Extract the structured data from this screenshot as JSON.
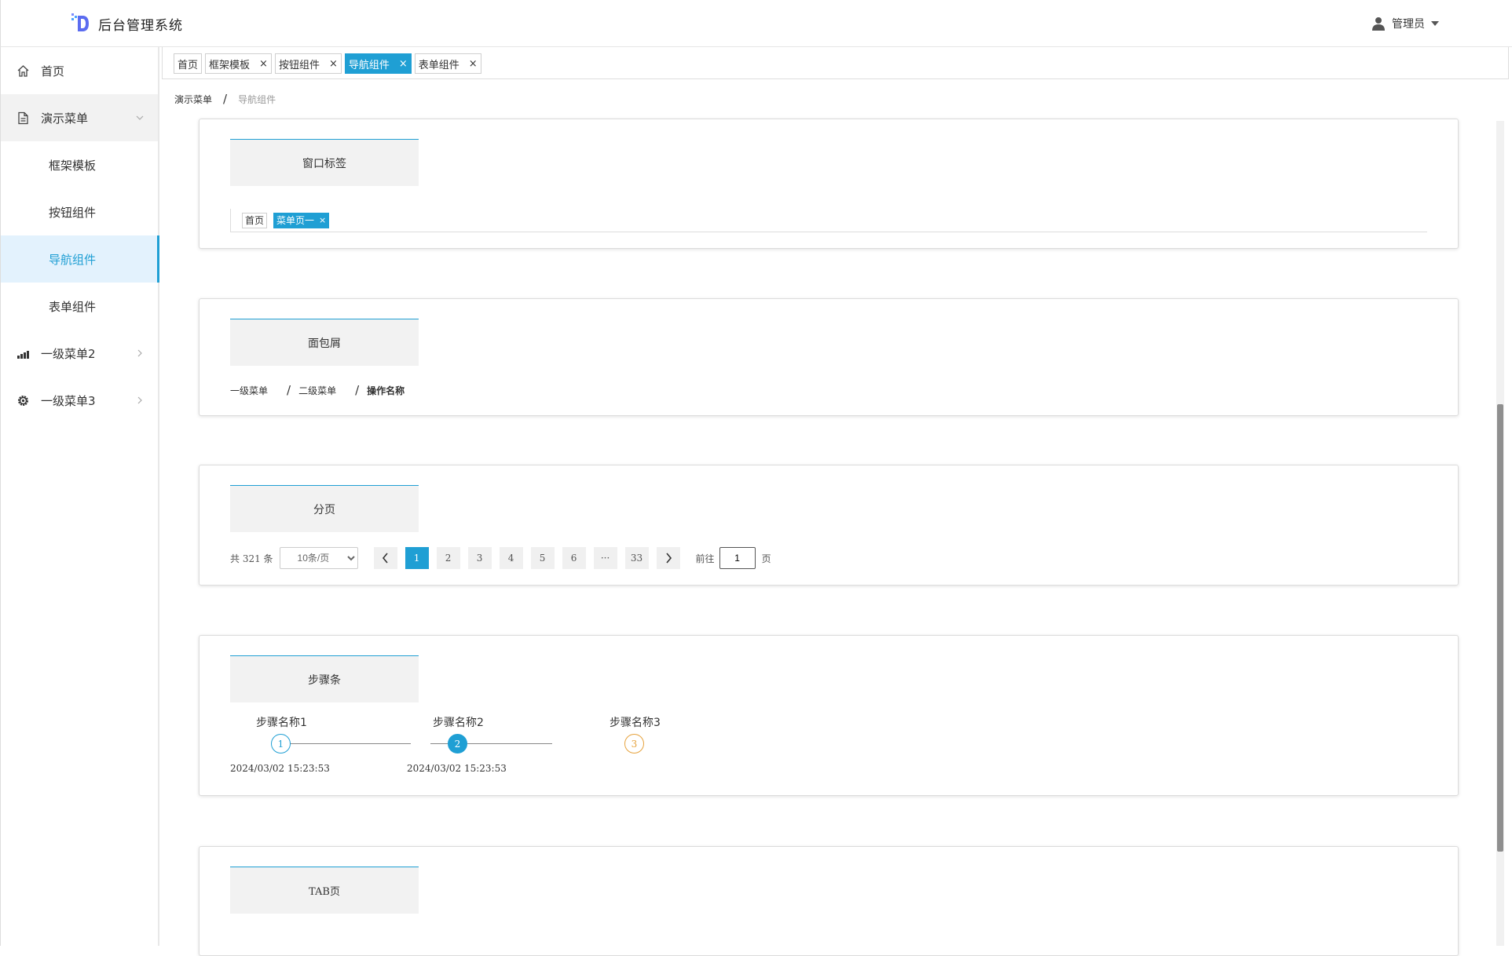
{
  "app": {
    "title": "后台管理系统"
  },
  "user": {
    "name": "管理员"
  },
  "sidebar": {
    "items": [
      {
        "label": "首页",
        "icon": "home-icon"
      },
      {
        "label": "演示菜单",
        "icon": "document-icon"
      },
      {
        "label": "框架模板"
      },
      {
        "label": "按钮组件"
      },
      {
        "label": "导航组件"
      },
      {
        "label": "表单组件"
      },
      {
        "label": "一级菜单2",
        "icon": "bar-chart-icon"
      },
      {
        "label": "一级菜单3",
        "icon": "gear-icon"
      }
    ],
    "active": "导航组件"
  },
  "tabs": [
    {
      "label": "首页",
      "closable": false
    },
    {
      "label": "框架模板",
      "closable": true
    },
    {
      "label": "按钮组件",
      "closable": true
    },
    {
      "label": "导航组件",
      "closable": true,
      "active": true
    },
    {
      "label": "表单组件",
      "closable": true
    }
  ],
  "close_glyph": "×",
  "breadcrumb": {
    "parent": "演示菜单",
    "current": "导航组件",
    "separator": "/"
  },
  "cards": {
    "window_tags": {
      "title": "窗口标签",
      "tags": [
        {
          "label": "首页"
        },
        {
          "label": "菜单页一",
          "active": true
        }
      ]
    },
    "breadcrumb": {
      "title": "面包屑",
      "items": [
        "一级菜单",
        "二级菜单",
        "操作名称"
      ]
    },
    "pagination": {
      "title": "分页",
      "total_text": "共 321 条",
      "page_size": "10条/页",
      "pages": [
        "1",
        "2",
        "3",
        "4",
        "5",
        "6",
        "···",
        "33"
      ],
      "current_page": "1",
      "goto_prefix": "前往",
      "goto_value": "1",
      "goto_suffix": "页"
    },
    "steps": {
      "title": "步骤条",
      "items": [
        {
          "name": "步骤名称1",
          "number": "1",
          "time": "2024/03/02 15:23:53",
          "status": "done"
        },
        {
          "name": "步骤名称2",
          "number": "2",
          "time": "2024/03/02 15:23:53",
          "status": "current"
        },
        {
          "name": "步骤名称3",
          "number": "3",
          "time": "",
          "status": "todo"
        }
      ]
    },
    "tabs": {
      "title": "TAB页"
    }
  },
  "colors": {
    "accent": "#1f9fd4",
    "warning": "#e6a23c",
    "active_bg": "#e3f2fd"
  }
}
